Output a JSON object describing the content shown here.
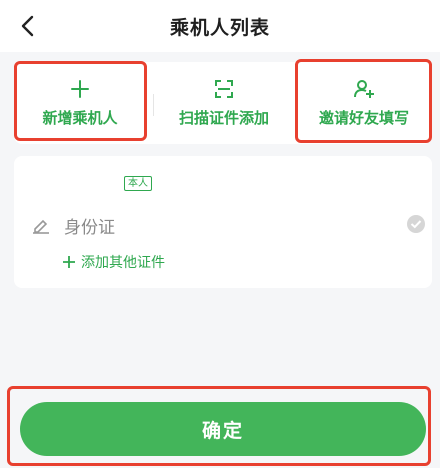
{
  "header": {
    "title": "乘机人列表",
    "back_icon": "chevron-left-icon"
  },
  "actions": [
    {
      "label": "新增乘机人",
      "icon": "plus-icon"
    },
    {
      "label": "扫描证件添加",
      "icon": "scan-icon"
    },
    {
      "label": "邀请好友填写",
      "icon": "user-add-icon"
    }
  ],
  "passenger": {
    "tag": "本人",
    "id_type": "身份证",
    "add_doc_label": "添加其他证件"
  },
  "confirm_label": "确定",
  "colors": {
    "accent": "#2fa84f",
    "button": "#43b55a",
    "highlight": "#e8402f"
  }
}
